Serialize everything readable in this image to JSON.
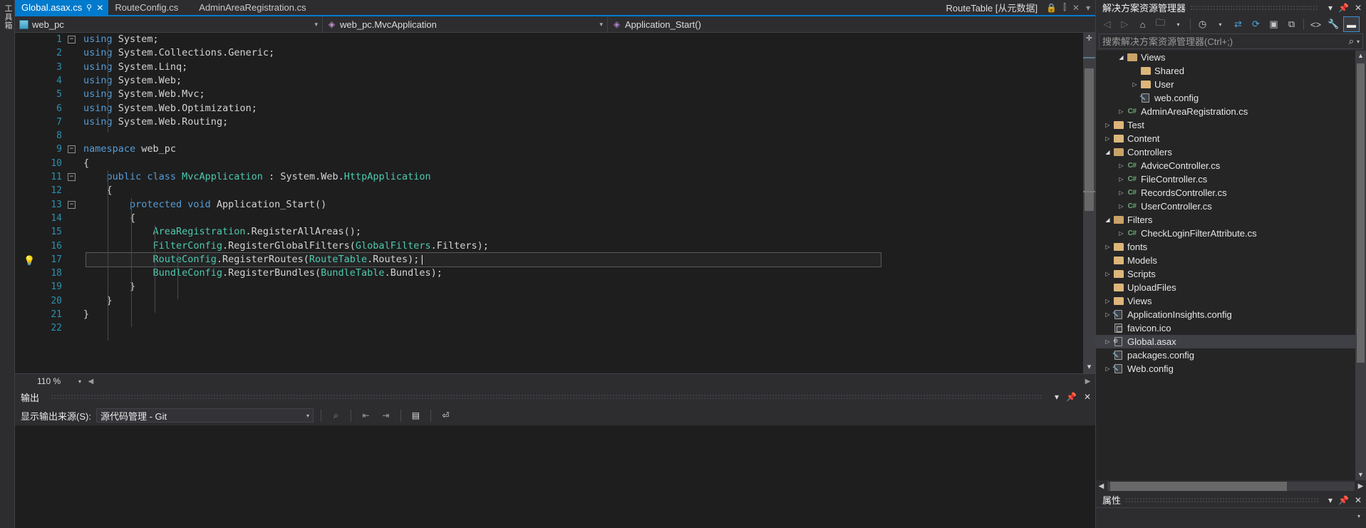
{
  "toolbox": {
    "label": "工具箱"
  },
  "tabs": {
    "items": [
      {
        "label": "Global.asax.cs",
        "active": true,
        "pin": "📌",
        "close": "✕"
      },
      {
        "label": "RouteConfig.cs",
        "active": false
      },
      {
        "label": "AdminAreaRegistration.cs",
        "active": false
      }
    ],
    "right_meta": "RouteTable [从元数据]",
    "right_icons": [
      "lock-icon",
      "split-icon",
      "close-icon",
      "chevron-down-icon"
    ]
  },
  "navbar": {
    "project": "web_pc",
    "class": "web_pc.MvcApplication",
    "member": "Application_Start()"
  },
  "editor": {
    "zoom": "110 %",
    "current_line": 17,
    "lines": [
      {
        "n": "1",
        "fold": "minus",
        "indent": 0,
        "tokens": [
          [
            "kw",
            "using"
          ],
          [
            "pl",
            " System;"
          ]
        ]
      },
      {
        "n": "2",
        "indent": 0,
        "tokens": [
          [
            "kw",
            "using"
          ],
          [
            "pl",
            " System.Collections.Generic;"
          ]
        ]
      },
      {
        "n": "3",
        "indent": 0,
        "tokens": [
          [
            "kw",
            "using"
          ],
          [
            "pl",
            " System.Linq;"
          ]
        ]
      },
      {
        "n": "4",
        "indent": 0,
        "tokens": [
          [
            "kw",
            "using"
          ],
          [
            "pl",
            " System.Web;"
          ]
        ]
      },
      {
        "n": "5",
        "indent": 0,
        "tokens": [
          [
            "kw",
            "using"
          ],
          [
            "pl",
            " System.Web.Mvc;"
          ]
        ]
      },
      {
        "n": "6",
        "indent": 0,
        "tokens": [
          [
            "kw",
            "using"
          ],
          [
            "pl",
            " System.Web.Optimization;"
          ]
        ]
      },
      {
        "n": "7",
        "indent": 0,
        "tokens": [
          [
            "kw",
            "using"
          ],
          [
            "pl",
            " System.Web.Routing;"
          ]
        ]
      },
      {
        "n": "8",
        "indent": 0,
        "tokens": []
      },
      {
        "n": "9",
        "fold": "minus",
        "indent": 0,
        "tokens": [
          [
            "kw",
            "namespace"
          ],
          [
            "pl",
            " web_pc"
          ]
        ]
      },
      {
        "n": "10",
        "indent": 0,
        "tokens": [
          [
            "pl",
            "{"
          ]
        ]
      },
      {
        "n": "11",
        "fold": "minus",
        "indent": 1,
        "tokens": [
          [
            "kw",
            "public class "
          ],
          [
            "typ",
            "MvcApplication"
          ],
          [
            "pl",
            " : System.Web."
          ],
          [
            "typ",
            "HttpApplication"
          ]
        ]
      },
      {
        "n": "12",
        "indent": 1,
        "tokens": [
          [
            "pl",
            "{"
          ]
        ]
      },
      {
        "n": "13",
        "fold": "minus",
        "indent": 2,
        "tokens": [
          [
            "kw",
            "protected void "
          ],
          [
            "pl",
            "Application_Start()"
          ]
        ]
      },
      {
        "n": "14",
        "indent": 2,
        "tokens": [
          [
            "pl",
            "{"
          ]
        ]
      },
      {
        "n": "15",
        "indent": 3,
        "tokens": [
          [
            "typ",
            "AreaRegistration"
          ],
          [
            "pl",
            ".RegisterAllAreas();"
          ]
        ]
      },
      {
        "n": "16",
        "indent": 3,
        "tokens": [
          [
            "typ",
            "FilterConfig"
          ],
          [
            "pl",
            ".RegisterGlobalFilters("
          ],
          [
            "typ",
            "GlobalFilters"
          ],
          [
            "pl",
            ".Filters);"
          ]
        ]
      },
      {
        "n": "17",
        "bulb": true,
        "current": true,
        "indent": 3,
        "tokens": [
          [
            "typ",
            "RouteConfig"
          ],
          [
            "pl",
            ".RegisterRoutes("
          ],
          [
            "typ",
            "RouteTable"
          ],
          [
            "pl",
            ".Routes);"
          ],
          [
            "caret",
            "|"
          ]
        ]
      },
      {
        "n": "18",
        "indent": 3,
        "tokens": [
          [
            "typ",
            "BundleConfig"
          ],
          [
            "pl",
            ".RegisterBundles("
          ],
          [
            "typ",
            "BundleTable"
          ],
          [
            "pl",
            ".Bundles);"
          ]
        ]
      },
      {
        "n": "19",
        "indent": 2,
        "tokens": [
          [
            "pl",
            "}"
          ]
        ]
      },
      {
        "n": "20",
        "indent": 1,
        "tokens": [
          [
            "pl",
            "}"
          ]
        ]
      },
      {
        "n": "21",
        "indent": 0,
        "tokens": [
          [
            "pl",
            "}"
          ]
        ]
      },
      {
        "n": "22",
        "indent": 0,
        "tokens": []
      }
    ]
  },
  "output": {
    "title": "输出",
    "source_label": "显示输出来源(S):",
    "source_value": "源代码管理 - Git",
    "icons": [
      "find-message-icon",
      "outdent-icon",
      "indent-icon",
      "clear-all-icon",
      "word-wrap-icon"
    ],
    "header_icons": [
      "chevron-down-icon",
      "pin-icon",
      "close-icon"
    ]
  },
  "solution_explorer": {
    "title": "解决方案资源管理器",
    "header_icons": [
      "chevron-down-icon",
      "pin-icon",
      "close-icon"
    ],
    "toolbar": [
      "back-icon",
      "forward-icon",
      "home-icon",
      "new-folder-icon",
      "chevron-down-icon",
      "pending-changes-icon",
      "chevron-down-icon",
      "sync-icon",
      "refresh-icon",
      "collapse-all-icon",
      "show-all-files-icon",
      "view-code-icon",
      "properties-icon",
      "preview-selected-icon"
    ],
    "search_placeholder": "搜索解决方案资源管理器(Ctrl+;)",
    "tree": [
      {
        "depth": 3,
        "twisty": "open",
        "icon": "folder-open",
        "label": "Views"
      },
      {
        "depth": 4,
        "twisty": "none",
        "icon": "folder",
        "label": "Shared"
      },
      {
        "depth": 4,
        "twisty": "closed",
        "icon": "folder",
        "label": "User"
      },
      {
        "depth": 4,
        "twisty": "none",
        "icon": "config-file",
        "label": "web.config"
      },
      {
        "depth": 3,
        "twisty": "closed",
        "icon": "csharp",
        "label": "AdminAreaRegistration.cs"
      },
      {
        "depth": 2,
        "twisty": "closed",
        "icon": "folder",
        "label": "Test"
      },
      {
        "depth": 2,
        "twisty": "closed",
        "icon": "folder",
        "label": "Content"
      },
      {
        "depth": 2,
        "twisty": "open",
        "icon": "folder-open",
        "label": "Controllers"
      },
      {
        "depth": 3,
        "twisty": "closed",
        "icon": "csharp",
        "label": "AdviceController.cs"
      },
      {
        "depth": 3,
        "twisty": "closed",
        "icon": "csharp",
        "label": "FileController.cs"
      },
      {
        "depth": 3,
        "twisty": "closed",
        "icon": "csharp",
        "label": "RecordsController.cs"
      },
      {
        "depth": 3,
        "twisty": "closed",
        "icon": "csharp",
        "label": "UserController.cs"
      },
      {
        "depth": 2,
        "twisty": "open",
        "icon": "folder-open",
        "label": "Filters"
      },
      {
        "depth": 3,
        "twisty": "closed",
        "icon": "csharp",
        "label": "CheckLoginFilterAttribute.cs"
      },
      {
        "depth": 2,
        "twisty": "closed",
        "icon": "folder",
        "label": "fonts"
      },
      {
        "depth": 2,
        "twisty": "none",
        "icon": "folder",
        "label": "Models"
      },
      {
        "depth": 2,
        "twisty": "closed",
        "icon": "folder",
        "label": "Scripts"
      },
      {
        "depth": 2,
        "twisty": "none",
        "icon": "folder",
        "label": "UploadFiles"
      },
      {
        "depth": 2,
        "twisty": "closed",
        "icon": "folder",
        "label": "Views"
      },
      {
        "depth": 2,
        "twisty": "closed",
        "icon": "config-file",
        "label": "ApplicationInsights.config"
      },
      {
        "depth": 2,
        "twisty": "none",
        "icon": "generic-file",
        "label": "favicon.ico"
      },
      {
        "depth": 2,
        "twisty": "closed",
        "icon": "asax-file",
        "label": "Global.asax",
        "selected": true
      },
      {
        "depth": 2,
        "twisty": "none",
        "icon": "config-file",
        "label": "packages.config"
      },
      {
        "depth": 2,
        "twisty": "closed",
        "icon": "config-file",
        "label": "Web.config"
      }
    ]
  },
  "properties": {
    "title": "属性",
    "header_icons": [
      "chevron-down-icon",
      "pin-icon",
      "close-icon"
    ]
  }
}
